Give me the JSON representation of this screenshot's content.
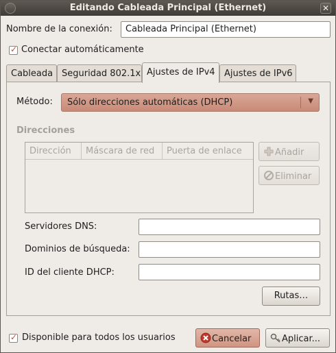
{
  "window": {
    "title": "Editando Cableada Principal (Ethernet)",
    "close_glyph": "✕"
  },
  "connection": {
    "name_label": "Nombre de la conexión:",
    "name_value": "Cableada Principal (Ethernet)"
  },
  "auto_connect": {
    "label": "Conectar automáticamente",
    "checked": true
  },
  "tabs": [
    {
      "label": "Cableada",
      "active": false
    },
    {
      "label": "Seguridad 802.1x",
      "active": false
    },
    {
      "label": "Ajustes de IPv4",
      "active": true
    },
    {
      "label": "Ajustes de IPv6",
      "active": false
    }
  ],
  "ipv4": {
    "method_label": "Método:",
    "method_value": "Sólo direcciones automáticas (DHCP)",
    "addresses_heading": "Direcciones",
    "columns": [
      "Dirección",
      "Máscara de red",
      "Puerta de enlace"
    ],
    "add_button": "Añadir",
    "delete_button": "Eliminar",
    "dns_label": "Servidores DNS:",
    "dns_value": "",
    "search_domains_label": "Dominios de búsqueda:",
    "search_domains_value": "",
    "dhcp_client_id_label": "ID del cliente DHCP:",
    "dhcp_client_id_value": "",
    "routes_button": "Rutas…"
  },
  "footer": {
    "all_users_label": "Disponible para todos los usuarios",
    "all_users_checked": true,
    "cancel_button": "Cancelar",
    "apply_button": "Aplicar..."
  },
  "colors": {
    "accent": "#d14b2d",
    "combo_bg": "#c98a78",
    "titlebar": "#4a4540"
  }
}
